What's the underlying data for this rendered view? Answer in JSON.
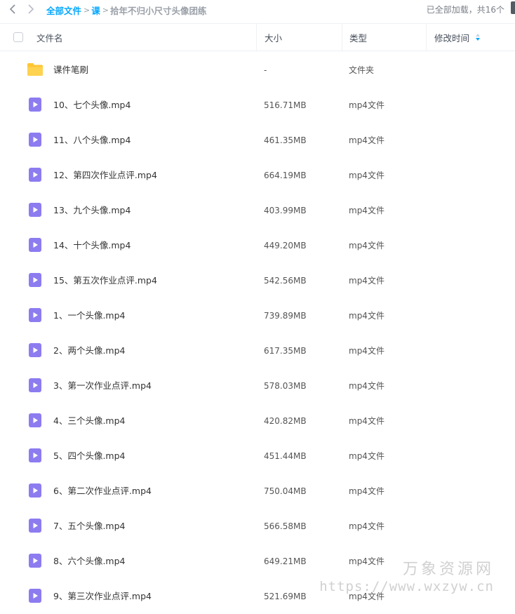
{
  "breadcrumb": {
    "root": "全部文件",
    "middle": "课",
    "current": "拾年不归小尺寸头像团练"
  },
  "loaded_info": "已全部加载，共16个",
  "columns": {
    "name": "文件名",
    "size": "大小",
    "type": "类型",
    "modified": "修改时间"
  },
  "files": [
    {
      "name": "课件笔刷",
      "size": "-",
      "type": "文件夹",
      "icon": "folder-icon"
    },
    {
      "name": "10、七个头像.mp4",
      "size": "516.71MB",
      "type": "mp4文件",
      "icon": "video-file-icon"
    },
    {
      "name": "11、八个头像.mp4",
      "size": "461.35MB",
      "type": "mp4文件",
      "icon": "video-file-icon"
    },
    {
      "name": "12、第四次作业点评.mp4",
      "size": "664.19MB",
      "type": "mp4文件",
      "icon": "video-file-icon"
    },
    {
      "name": "13、九个头像.mp4",
      "size": "403.99MB",
      "type": "mp4文件",
      "icon": "video-file-icon"
    },
    {
      "name": "14、十个头像.mp4",
      "size": "449.20MB",
      "type": "mp4文件",
      "icon": "video-file-icon"
    },
    {
      "name": "15、第五次作业点评.mp4",
      "size": "542.56MB",
      "type": "mp4文件",
      "icon": "video-file-icon"
    },
    {
      "name": "1、一个头像.mp4",
      "size": "739.89MB",
      "type": "mp4文件",
      "icon": "video-file-icon"
    },
    {
      "name": "2、两个头像.mp4",
      "size": "617.35MB",
      "type": "mp4文件",
      "icon": "video-file-icon"
    },
    {
      "name": "3、第一次作业点评.mp4",
      "size": "578.03MB",
      "type": "mp4文件",
      "icon": "video-file-icon"
    },
    {
      "name": "4、三个头像.mp4",
      "size": "420.82MB",
      "type": "mp4文件",
      "icon": "video-file-icon"
    },
    {
      "name": "5、四个头像.mp4",
      "size": "451.44MB",
      "type": "mp4文件",
      "icon": "video-file-icon"
    },
    {
      "name": "6、第二次作业点评.mp4",
      "size": "750.04MB",
      "type": "mp4文件",
      "icon": "video-file-icon"
    },
    {
      "name": "7、五个头像.mp4",
      "size": "566.58MB",
      "type": "mp4文件",
      "icon": "video-file-icon"
    },
    {
      "name": "8、六个头像.mp4",
      "size": "649.21MB",
      "type": "mp4文件",
      "icon": "video-file-icon"
    },
    {
      "name": "9、第三次作业点评.mp4",
      "size": "521.69MB",
      "type": "mp4文件",
      "icon": "video-file-icon"
    }
  ],
  "watermark": {
    "name": "万象资源网",
    "url": "https://www.wxzyw.cn"
  },
  "colors": {
    "accent": "#06a7ff",
    "folder": "#ffc634",
    "video_icon": "#8c7cf0"
  }
}
